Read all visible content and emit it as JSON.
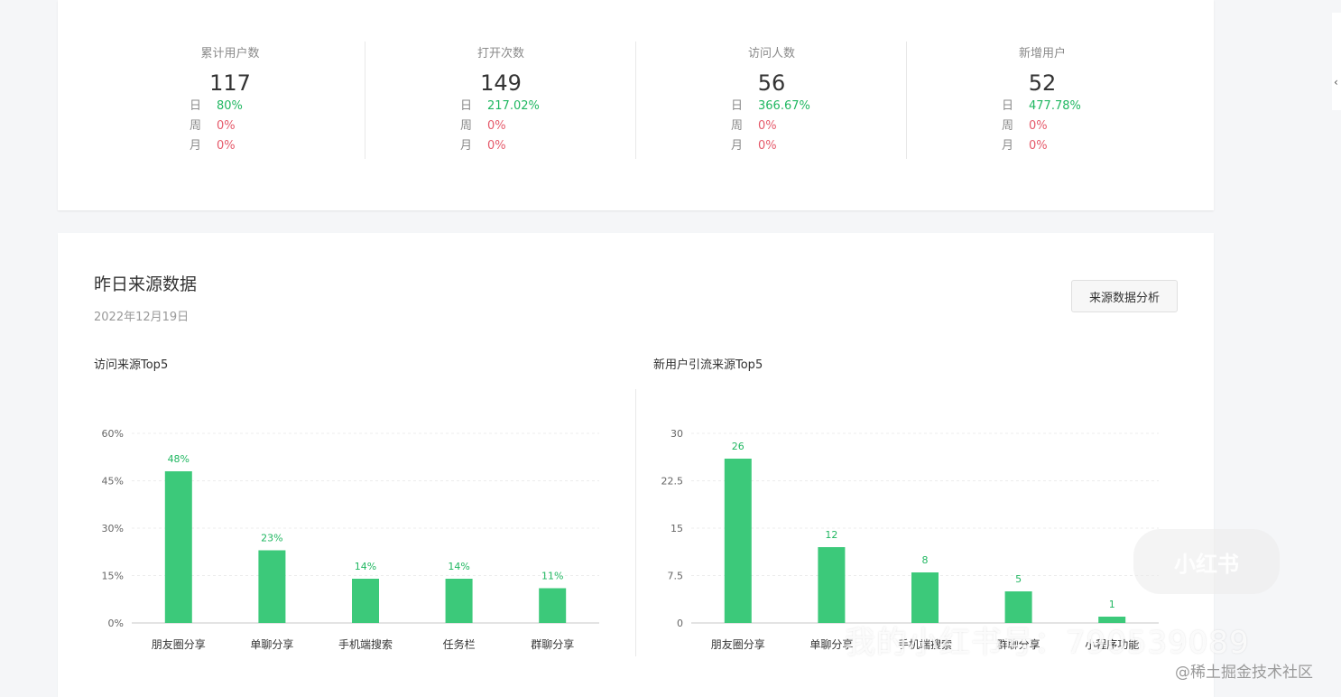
{
  "stats": [
    {
      "label": "累计用户数",
      "value": "117",
      "day_label": "日",
      "day": "80%",
      "week_label": "周",
      "week": "0%",
      "month_label": "月",
      "month": "0%"
    },
    {
      "label": "打开次数",
      "value": "149",
      "day_label": "日",
      "day": "217.02%",
      "week_label": "周",
      "week": "0%",
      "month_label": "月",
      "month": "0%"
    },
    {
      "label": "访问人数",
      "value": "56",
      "day_label": "日",
      "day": "366.67%",
      "week_label": "周",
      "week": "0%",
      "month_label": "月",
      "month": "0%"
    },
    {
      "label": "新增用户",
      "value": "52",
      "day_label": "日",
      "day": "477.78%",
      "week_label": "周",
      "week": "0%",
      "month_label": "月",
      "month": "0%"
    }
  ],
  "source": {
    "title": "昨日来源数据",
    "date": "2022年12月19日",
    "analyze_button": "来源数据分析"
  },
  "colors": {
    "bar": "#3cc97a",
    "positive": "#20b761",
    "zero": "#e55a6b"
  },
  "chart_data": [
    {
      "type": "bar",
      "title": "访问来源Top5",
      "categories": [
        "朋友圈分享",
        "单聊分享",
        "手机端搜索",
        "任务栏",
        "群聊分享"
      ],
      "values": [
        48,
        23,
        14,
        14,
        11
      ],
      "value_labels": [
        "48%",
        "23%",
        "14%",
        "14%",
        "11%"
      ],
      "yticks": [
        "0%",
        "15%",
        "30%",
        "45%",
        "60%"
      ],
      "ylim": [
        0,
        60
      ],
      "grid": true
    },
    {
      "type": "bar",
      "title": "新用户引流来源Top5",
      "categories": [
        "朋友圈分享",
        "单聊分享",
        "手机端搜索",
        "群聊分享",
        "小程序功能"
      ],
      "values": [
        26,
        12,
        8,
        5,
        1
      ],
      "value_labels": [
        "26",
        "12",
        "8",
        "5",
        "1"
      ],
      "yticks": [
        "0",
        "7.5",
        "15",
        "22.5",
        "30"
      ],
      "ylim": [
        0,
        30
      ],
      "grid": true
    }
  ],
  "watermark": {
    "text": "我的小红书号：790539089",
    "logo": "小红书",
    "site": "@稀土掘金技术社区"
  }
}
